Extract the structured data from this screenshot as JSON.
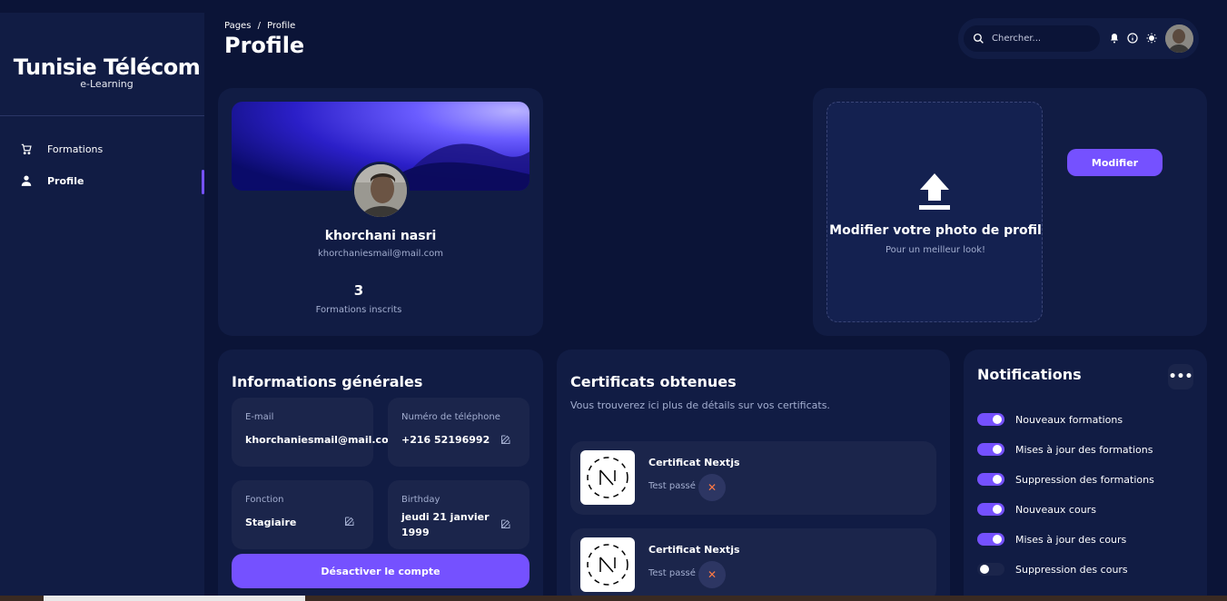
{
  "sidebar": {
    "brand_name": "Tunisie Télécom",
    "brand_sub": "e-Learning",
    "items": [
      {
        "label": "Formations",
        "icon": "cart-icon"
      },
      {
        "label": "Profile",
        "icon": "user-icon",
        "active": true
      }
    ]
  },
  "header": {
    "breadcrumb_root": "Pages",
    "breadcrumb_sep": "/",
    "breadcrumb_current": "Profile",
    "title": "Profile"
  },
  "search": {
    "placeholder": "Chercher..."
  },
  "profile": {
    "name": "khorchani nasri",
    "email": "khorchaniesmail@mail.com",
    "stat_value": "3",
    "stat_label": "Formations inscrits"
  },
  "upload": {
    "title": "Modifier votre photo de profil",
    "subtitle": "Pour un meilleur look!",
    "button": "Modifier"
  },
  "info": {
    "title": "Informations générales",
    "fields": [
      {
        "label": "E-mail",
        "value": "khorchaniesmail@mail.com"
      },
      {
        "label": "Numéro de téléphone",
        "value": "+216 52196992"
      },
      {
        "label": "Fonction",
        "value": "Stagiaire"
      },
      {
        "label": "Birthday",
        "value": "jeudi 21 janvier 1999"
      }
    ],
    "deactivate_button": "Désactiver le compte"
  },
  "certificates": {
    "title": "Certificats obtenues",
    "subtitle": "Vous trouverez ici plus de détails sur vos certificats.",
    "items": [
      {
        "title": "Certificat Nextjs",
        "test_label": "Test passé :",
        "status": "✕"
      },
      {
        "title": "Certificat Nextjs",
        "test_label": "Test passé :",
        "status": "✕"
      }
    ]
  },
  "notifications": {
    "title": "Notifications",
    "more": "•••",
    "items": [
      {
        "label": "Nouveaux formations",
        "on": true
      },
      {
        "label": "Mises à jour des formations",
        "on": true
      },
      {
        "label": "Suppression des formations",
        "on": true
      },
      {
        "label": "Nouveaux cours",
        "on": true
      },
      {
        "label": "Mises à jour des cours",
        "on": true
      },
      {
        "label": "Suppression des cours",
        "on": false
      }
    ]
  },
  "colors": {
    "accent": "#7551ff",
    "background": "#0b1437",
    "card": "#111c44",
    "muted_text": "#a3aed0"
  }
}
